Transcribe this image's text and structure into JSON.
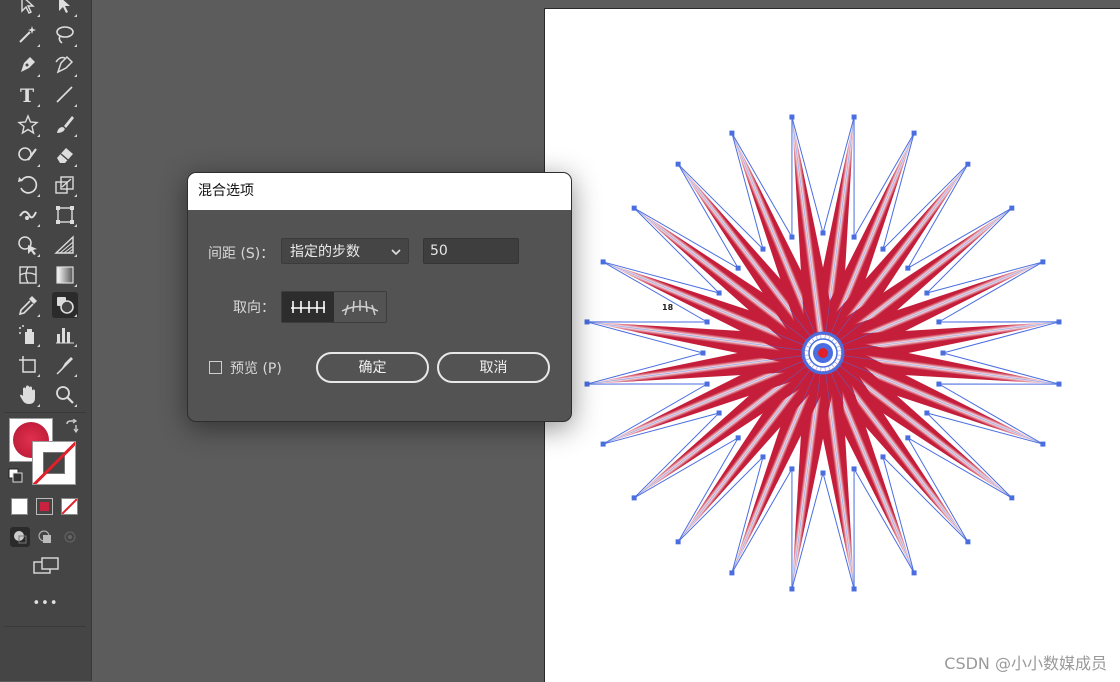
{
  "toolbar": {
    "tools": [
      {
        "name": "selection-icon"
      },
      {
        "name": "direct-selection-icon"
      },
      {
        "name": "magic-wand-icon"
      },
      {
        "name": "lasso-icon"
      },
      {
        "name": "pen-icon"
      },
      {
        "name": "curvature-icon"
      },
      {
        "name": "type-icon",
        "glyph": "T"
      },
      {
        "name": "line-icon"
      },
      {
        "name": "star-icon"
      },
      {
        "name": "paintbrush-icon"
      },
      {
        "name": "shaper-icon"
      },
      {
        "name": "eraser-icon"
      },
      {
        "name": "rotate-icon"
      },
      {
        "name": "scale-icon"
      },
      {
        "name": "width-icon"
      },
      {
        "name": "free-transform-icon"
      },
      {
        "name": "shape-builder-icon"
      },
      {
        "name": "perspective-grid-icon"
      },
      {
        "name": "mesh-icon"
      },
      {
        "name": "gradient-icon"
      },
      {
        "name": "eyedropper-icon"
      },
      {
        "name": "blend-icon"
      },
      {
        "name": "symbol-sprayer-icon"
      },
      {
        "name": "graph-icon"
      },
      {
        "name": "artboard-icon"
      },
      {
        "name": "slice-icon"
      },
      {
        "name": "hand-icon"
      },
      {
        "name": "zoom-icon"
      }
    ],
    "more_label": "•••",
    "fill_color": "#c9223f",
    "stroke_color": "none"
  },
  "canvas": {
    "point_label": "18",
    "star_color_dark": "#c41e3a",
    "star_color_light": "#ffffff",
    "path_color": "#4a6ee0",
    "watermark": "CSDN @小小数媒成员"
  },
  "dialog": {
    "title": "混合选项",
    "spacing_label": "间距 (S)：",
    "spacing_value": "指定的步数",
    "steps_value": "50",
    "orientation_label": "取向：",
    "preview_label": "预览 (P)",
    "ok_label": "确定",
    "cancel_label": "取消"
  }
}
